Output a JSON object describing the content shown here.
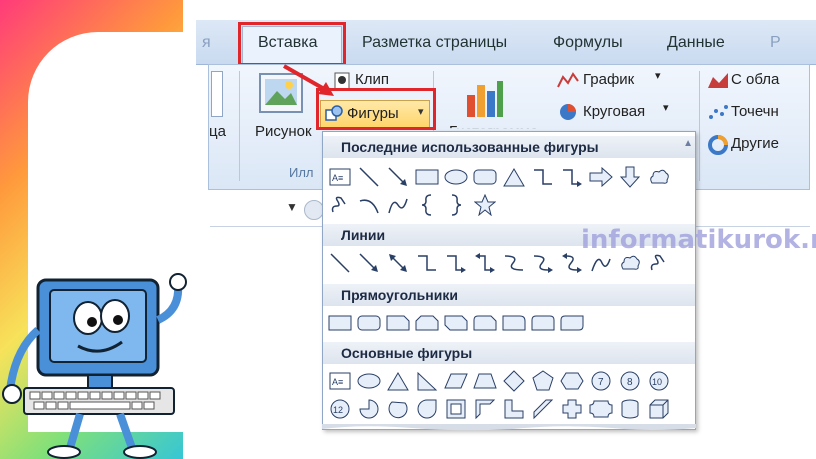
{
  "tabs": [
    {
      "label": "я"
    },
    {
      "label": "Вставка"
    },
    {
      "label": "Разметка страницы"
    },
    {
      "label": "Формулы"
    },
    {
      "label": "Данные"
    },
    {
      "label": "Р"
    }
  ],
  "ribbon": {
    "partial_label": "ца",
    "picture_label": "Рисунок",
    "clip_label": "Клип",
    "shapes_label": "Фигуры",
    "histogram_partial": "Гистограмма",
    "chart_graph_label": "График",
    "chart_pie_label": "Круговая",
    "right_area_label": "С обла",
    "right_scatter_label": "Точечн",
    "right_other_label": "Другие",
    "group_illustrations_partial": "Илл"
  },
  "dropdown": {
    "sections": [
      {
        "title": "Последние использованные фигуры"
      },
      {
        "title": "Линии"
      },
      {
        "title": "Прямоугольники"
      },
      {
        "title": "Основные фигуры"
      }
    ]
  },
  "watermark": "informatikurok.ru",
  "colors": {
    "highlight": "#e0262b",
    "ribbon_bg": "#dbe7f6",
    "accent": "#ffd56b"
  }
}
